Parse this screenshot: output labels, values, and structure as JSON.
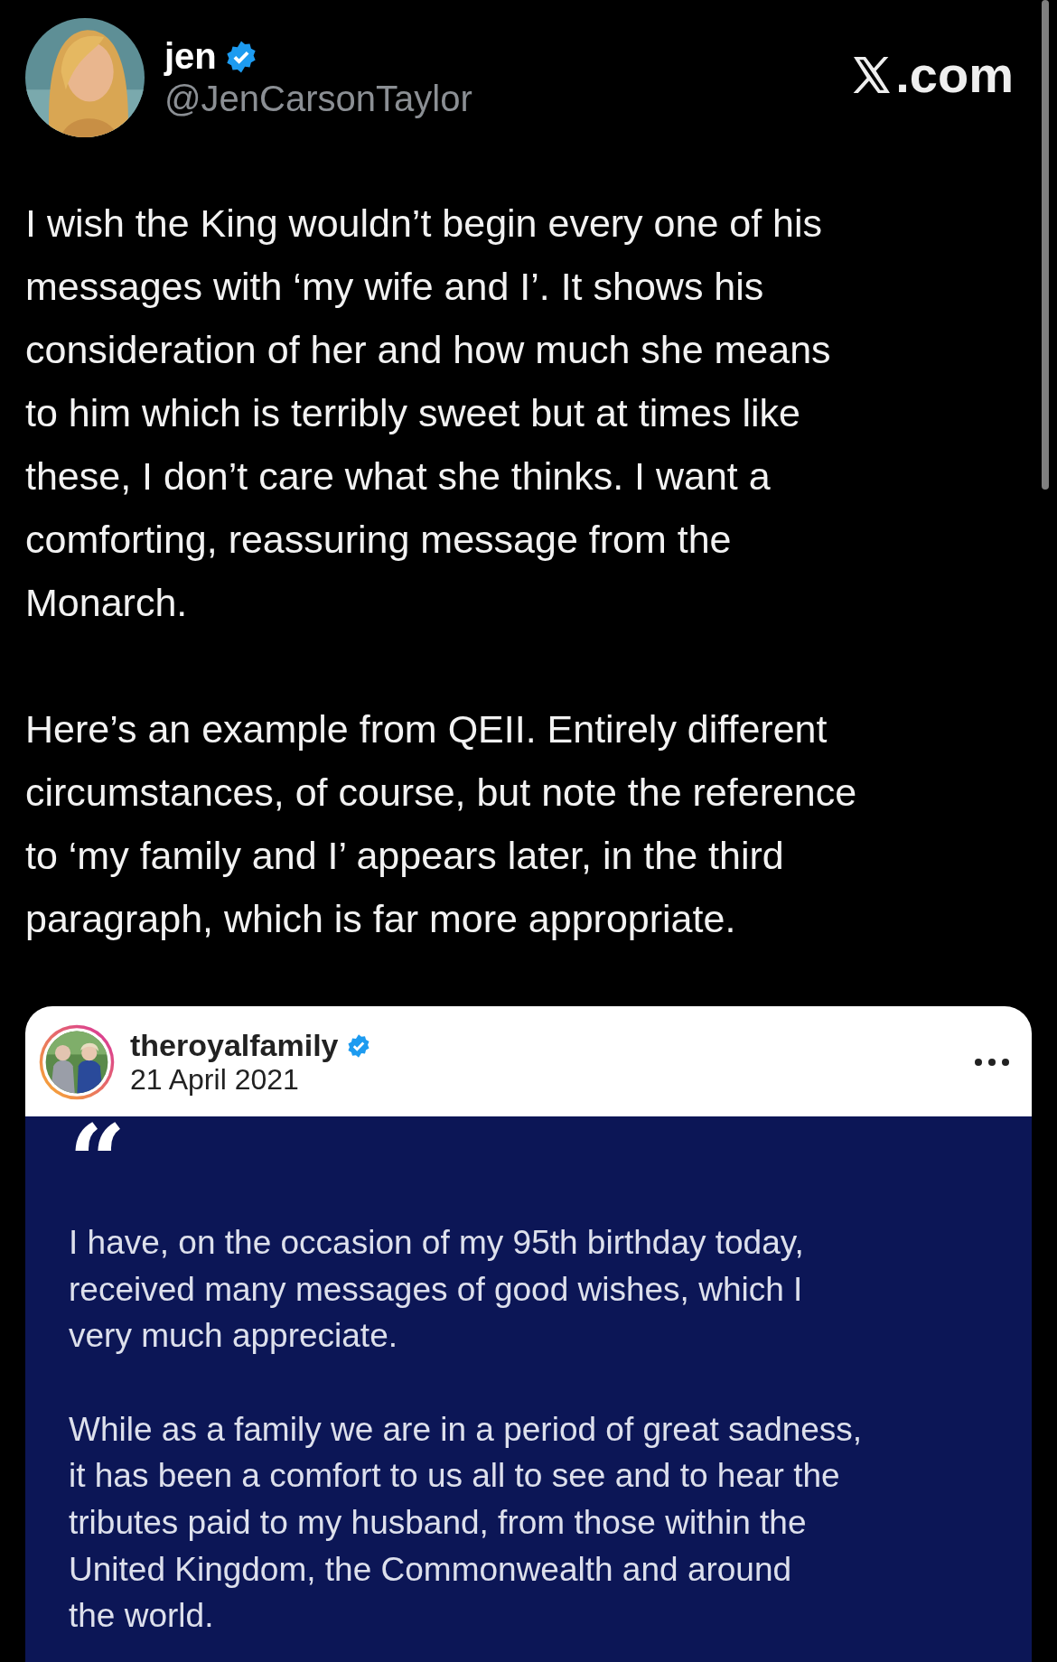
{
  "author": {
    "name": "jen",
    "verified": true,
    "handle": "@JenCarsonTaylor"
  },
  "site": {
    "suffix": ".com"
  },
  "post": {
    "paragraphs": [
      "I wish the King wouldn’t begin every one of his\nmessages with ‘my wife and I’. It shows his\nconsideration of her and how much she means\nto him which is terribly sweet but at times like\nthese, I don’t care what she thinks. I want a\ncomforting, reassuring message from the\nMonarch.",
      "Here’s an example from QEII. Entirely different\ncircumstances, of course, but note the reference\nto ‘my family and I’ appears later, in the third\nparagraph, which is far more appropriate."
    ]
  },
  "embed": {
    "account": "theroyalfamily",
    "verified": true,
    "date": "21 April 2021",
    "quote_mark": "“",
    "paragraphs": [
      "I have, on the occasion of my 95th birthday today,\nreceived many messages of good wishes, which I\nvery much appreciate.",
      "While as a family we are in a period of great sadness,\nit has been a comfort to us all to see and to hear the\ntributes paid to my husband, from those within the\nUnited Kingdom, the Commonwealth and around\nthe world."
    ]
  }
}
